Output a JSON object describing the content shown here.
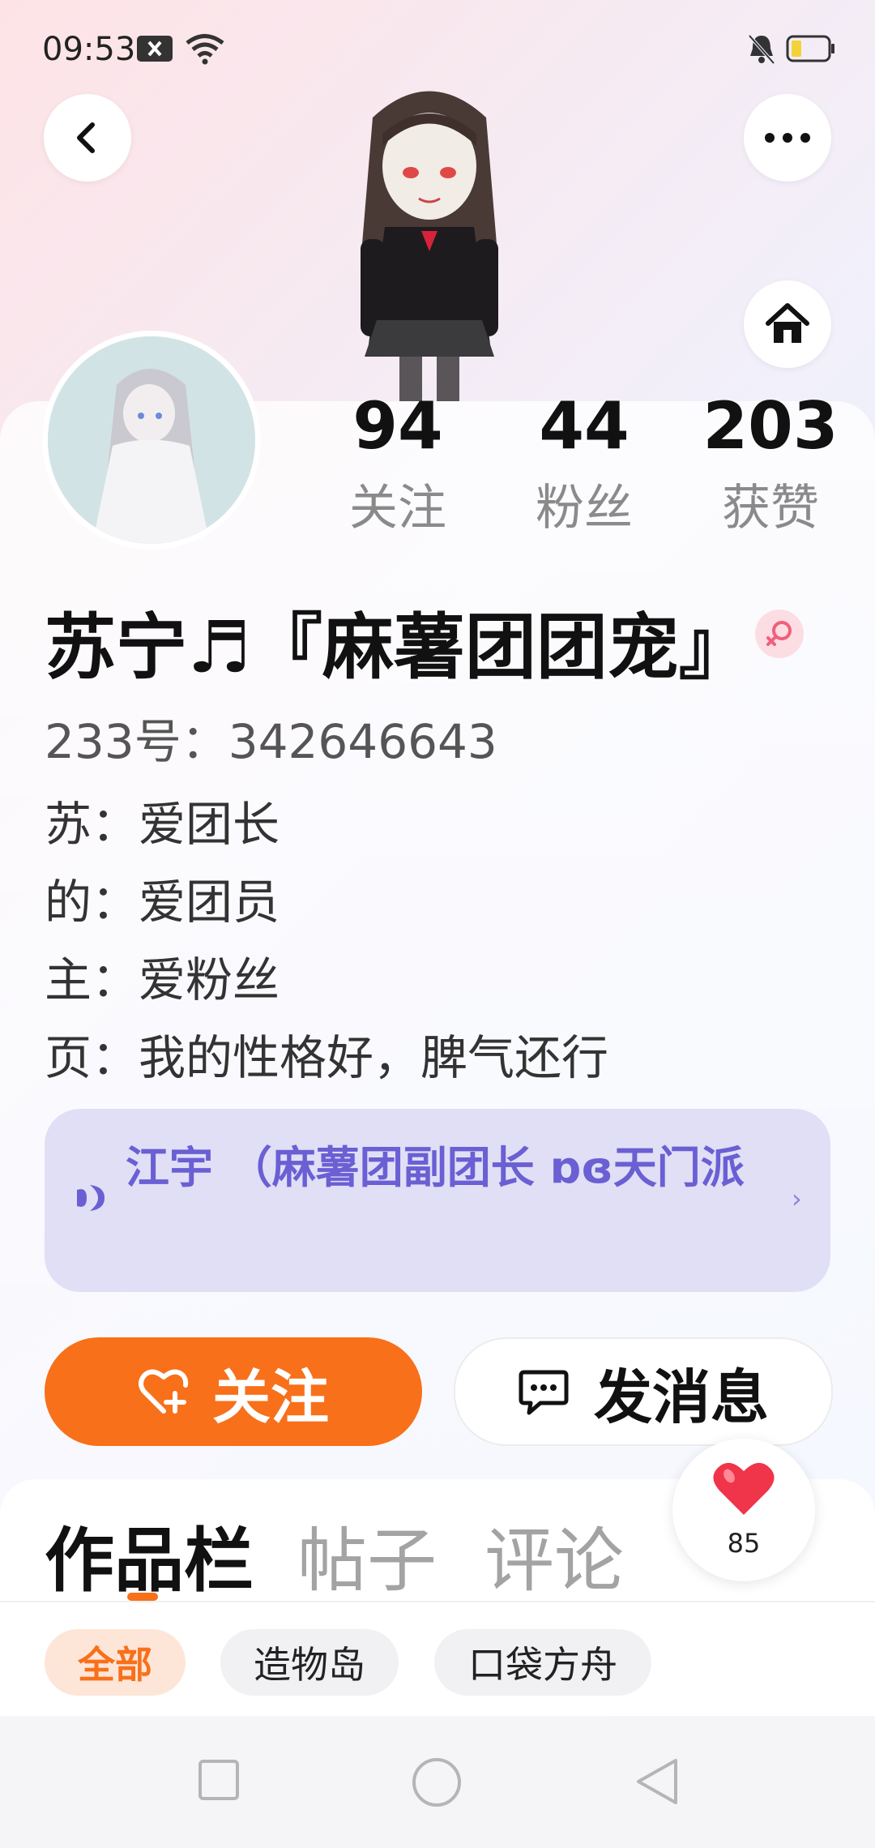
{
  "status_bar": {
    "time": "09:53"
  },
  "header": {
    "back_icon": "chevron-left-icon",
    "more_icon": "ellipsis-icon",
    "home_icon": "home-icon"
  },
  "stats": [
    {
      "value": "94",
      "label": "关注"
    },
    {
      "value": "44",
      "label": "粉丝"
    },
    {
      "value": "203",
      "label": "获赞"
    }
  ],
  "profile": {
    "name": "苏宁♬『麻薯团团宠』",
    "uid": "233号：342646643",
    "gender": "female",
    "bio": [
      "苏：爱团长",
      "的：爱团员",
      "主：爱粉丝",
      "页：我的性格好，脾气还行"
    ]
  },
  "announcement": {
    "text": "江宇 （麻薯团副团长 ɒɞ天门派",
    "chevron": "›"
  },
  "actions": {
    "follow_label": "关注",
    "message_label": "发消息"
  },
  "tabs": [
    {
      "label": "作品栏",
      "active": true
    },
    {
      "label": "帖子",
      "active": false
    },
    {
      "label": "评论",
      "active": false
    }
  ],
  "like_bubble": {
    "count": "85"
  },
  "filters": [
    {
      "label": "全部",
      "active": true
    },
    {
      "label": "造物岛",
      "active": false
    },
    {
      "label": "口袋方舟",
      "active": false
    }
  ],
  "colors": {
    "accent": "#f8701a",
    "announcement_bg": "#e0dff6",
    "announcement_text": "#6a5fd3",
    "heart": "#f0344a"
  }
}
